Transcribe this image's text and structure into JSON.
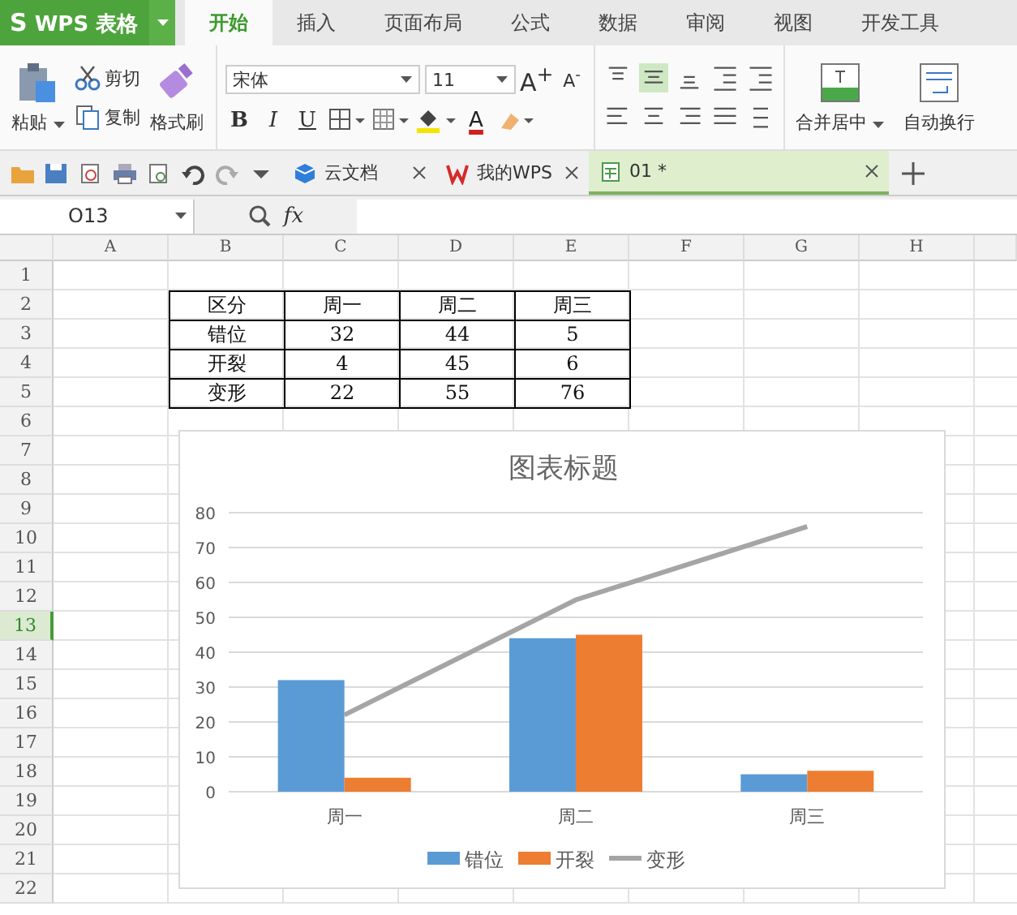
{
  "app": {
    "logo_text": "WPS 表格",
    "logo_mark": "S"
  },
  "tabs": [
    {
      "label": "开始",
      "selected": true
    },
    {
      "label": "插入",
      "selected": false
    },
    {
      "label": "页面布局",
      "selected": false
    },
    {
      "label": "公式",
      "selected": false
    },
    {
      "label": "数据",
      "selected": false
    },
    {
      "label": "审阅",
      "selected": false
    },
    {
      "label": "视图",
      "selected": false
    },
    {
      "label": "开发工具",
      "selected": false
    }
  ],
  "ribbon": {
    "paste": "粘贴",
    "cut": "剪切",
    "copy": "复制",
    "format_painter": "格式刷",
    "font": "宋体",
    "font_size": "11",
    "grow_font": "A$^{+}$",
    "shrink_font": "A$^{-}$",
    "bold": "B",
    "italic": "I",
    "underline": "U",
    "font_color": "A",
    "align_top": [
      {
        "kind": "top",
        "selected": false
      },
      {
        "kind": "middle",
        "selected": true
      },
      {
        "kind": "bottom",
        "selected": false
      },
      {
        "kind": "outdent",
        "selected": false
      },
      {
        "kind": "indent",
        "selected": false
      }
    ],
    "align_bottom": [
      {
        "kind": "left",
        "selected": false
      },
      {
        "kind": "center",
        "selected": false
      },
      {
        "kind": "right",
        "selected": false
      },
      {
        "kind": "justify",
        "selected": false
      },
      {
        "kind": "distribute",
        "selected": false
      }
    ],
    "merge": "合并居中",
    "wrap": "自动换行"
  },
  "doc_tabs": [
    {
      "kind": "cloud",
      "label": "云文档",
      "selected": false
    },
    {
      "kind": "wps",
      "label": "我的WPS",
      "selected": false
    },
    {
      "kind": "sheet",
      "label": "01 *",
      "selected": true
    }
  ],
  "formula_bar": {
    "cell_ref": "O13",
    "fx": "fx"
  },
  "sheet": {
    "columns": [
      "A",
      "B",
      "C",
      "D",
      "E",
      "F",
      "G",
      "H"
    ],
    "rows": [
      {
        "label": "1",
        "selected": false
      },
      {
        "label": "2",
        "selected": false,
        "cells": [
          "区分",
          "周一",
          "周二",
          "周三"
        ]
      },
      {
        "label": "3",
        "selected": false,
        "cells": [
          "错位",
          "32",
          "44",
          "5"
        ]
      },
      {
        "label": "4",
        "selected": false,
        "cells": [
          "开裂",
          "4",
          "45",
          "6"
        ]
      },
      {
        "label": "5",
        "selected": false,
        "cells": [
          "变形",
          "22",
          "55",
          "76"
        ]
      },
      {
        "label": "6",
        "selected": false
      },
      {
        "label": "7",
        "selected": false
      },
      {
        "label": "8",
        "selected": false
      },
      {
        "label": "9",
        "selected": false
      },
      {
        "label": "10",
        "selected": false
      },
      {
        "label": "11",
        "selected": false
      },
      {
        "label": "12",
        "selected": false
      },
      {
        "label": "13",
        "selected": true
      },
      {
        "label": "14",
        "selected": false
      },
      {
        "label": "15",
        "selected": false
      },
      {
        "label": "16",
        "selected": false
      },
      {
        "label": "17",
        "selected": false
      },
      {
        "label": "18",
        "selected": false
      },
      {
        "label": "19",
        "selected": false
      },
      {
        "label": "20",
        "selected": false
      },
      {
        "label": "21",
        "selected": false
      },
      {
        "label": "22",
        "selected": false
      }
    ],
    "chart_data": {
      "type": "bar",
      "title": "图表标题",
      "categories": [
        "周一",
        "周二",
        "周三"
      ],
      "series": [
        {
          "name": "错位",
          "type": "bar",
          "color": "#5b9bd5",
          "values": [
            32,
            44,
            5
          ]
        },
        {
          "name": "开裂",
          "type": "bar",
          "color": "#ed7d31",
          "values": [
            4,
            45,
            6
          ]
        },
        {
          "name": "变形",
          "type": "line",
          "color": "#a5a5a5",
          "values": [
            22,
            55,
            76
          ]
        }
      ],
      "grid": true,
      "legend": true,
      "ylim": [
        0,
        80
      ],
      "yticks": [
        0,
        10,
        20,
        30,
        40,
        50,
        60,
        70,
        80
      ]
    }
  }
}
